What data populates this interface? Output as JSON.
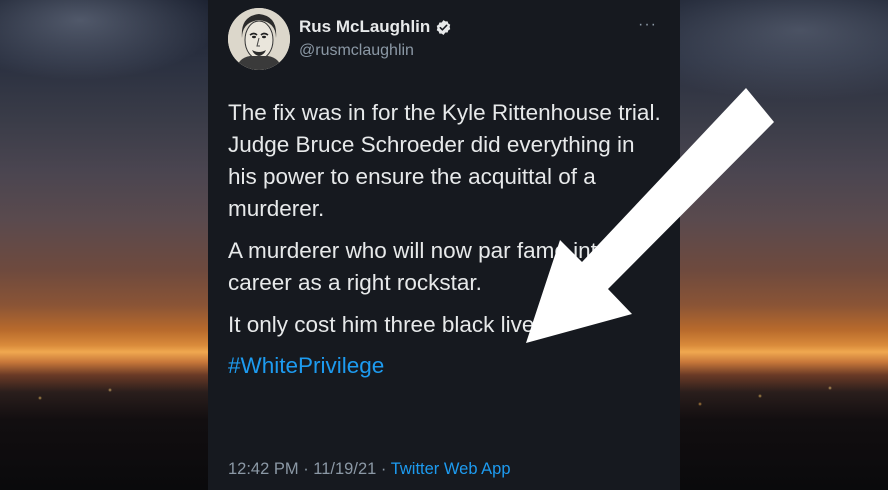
{
  "tweet": {
    "author_name": "Rus McLaughlin",
    "handle": "@rusmclaughlin",
    "more_label": "···",
    "paragraphs": [
      "The fix was in for the Kyle Rittenhouse trial. Judge Bruce Schroeder did everything in his power to ensure the acquittal of a murderer.",
      "A murderer who will now par fame into a career as a right rockstar.",
      "It only cost him three black lives."
    ],
    "hashtag": "#WhitePrivilege",
    "time": "12:42 PM",
    "date": "11/19/21",
    "separator": " · ",
    "source": "Twitter Web App"
  },
  "colors": {
    "card_background": "#16191f",
    "text": "#e7e9ea",
    "muted": "#8b98a5",
    "link": "#1d9bf0",
    "arrow": "#ffffff"
  },
  "icons": {
    "verified": "verified-badge-icon",
    "more": "more-options-icon",
    "overlay": "arrow-pointer-icon"
  }
}
